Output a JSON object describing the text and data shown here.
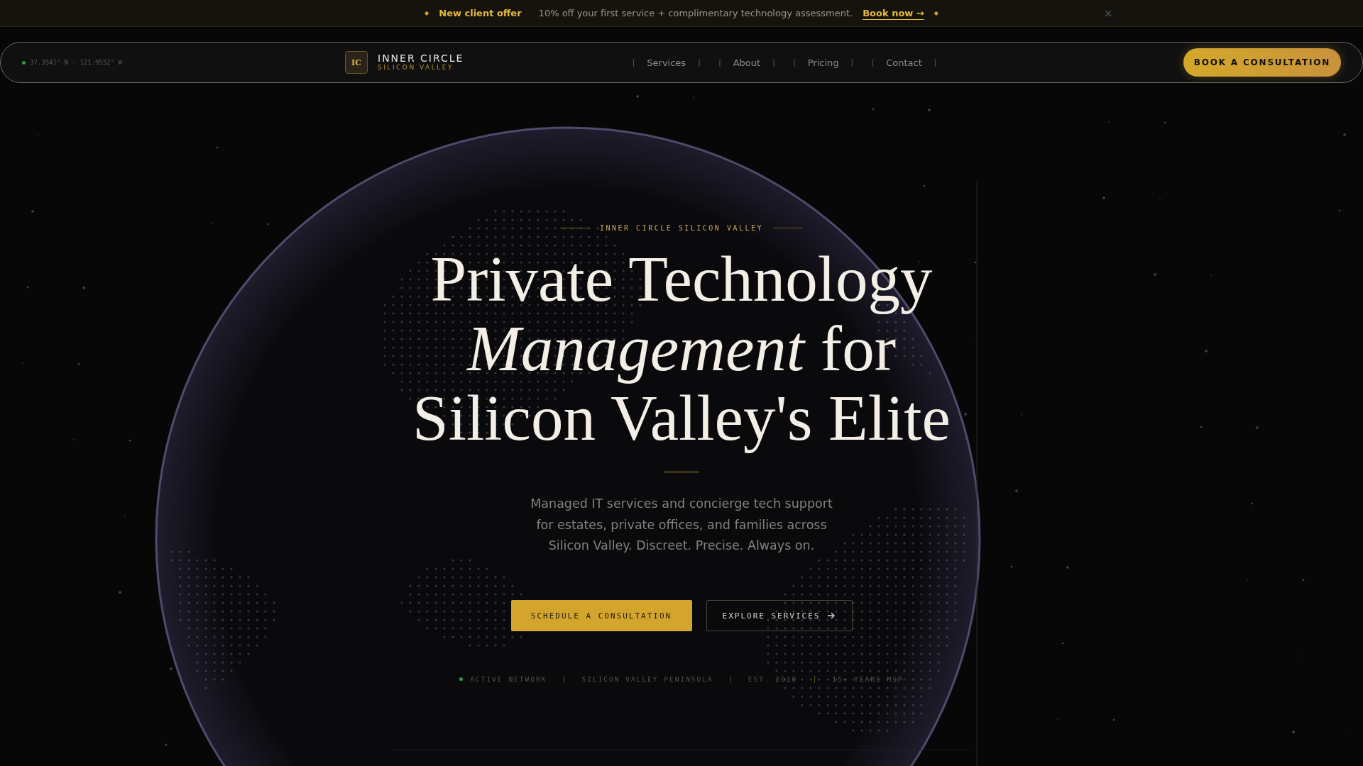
{
  "banner": {
    "left_mark": "◆",
    "title": "New client offer",
    "message": "10% off your first service + complimentary technology assessment.",
    "link": "Book now →",
    "right_mark": "◆",
    "close": "×"
  },
  "nav": {
    "coordinates": "37.3541° N · 121.9552° W",
    "logo_mark": "IC",
    "brand": "INNER CIRCLE",
    "brand_sub": "SILICON VALLEY",
    "links": [
      {
        "open": "[",
        "label": "Services",
        "close": "]"
      },
      {
        "open": "[",
        "label": "About",
        "close": "]"
      },
      {
        "open": "[",
        "label": "Pricing",
        "close": "]"
      },
      {
        "open": "[",
        "label": "Contact",
        "close": "]"
      }
    ],
    "cta": "BOOK A CONSULTATION"
  },
  "hero": {
    "eyebrow": "INNER CIRCLE SILICON VALLEY",
    "heading_lines": [
      "Private Technology",
      "*Management* for",
      "Silicon Valley's Elite"
    ],
    "description": "Managed IT services and concierge tech support for estates, private offices, and families across Silicon Valley. Discreet. Precise. Always on.",
    "primary_button": "SCHEDULE A CONSULTATION",
    "secondary_button": "EXPLORE SERVICES",
    "stats": [
      {
        "kind": "status",
        "text": "ACTIVE NETWORK"
      },
      {
        "kind": "plain",
        "text": "SILICON VALLEY PENINSULA"
      },
      {
        "kind": "plain",
        "text": "EST. 2010"
      },
      {
        "kind": "plain",
        "text": "15+ YEARS MSP"
      }
    ]
  }
}
